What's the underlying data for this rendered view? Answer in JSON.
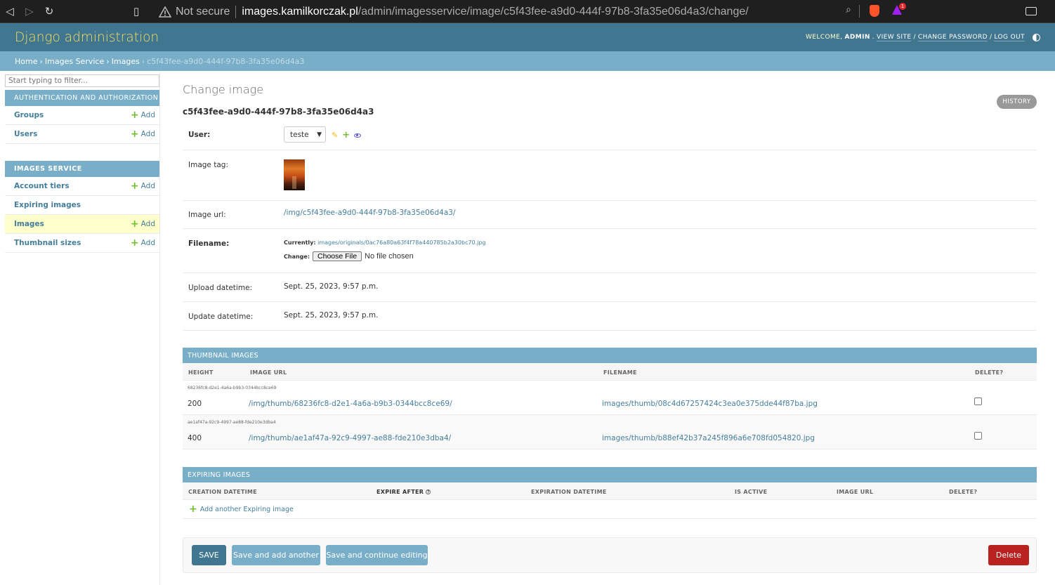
{
  "browser": {
    "security_label": "Not secure",
    "url_host": "images.kamilkorczak.pl",
    "url_path": "/admin/imagesservice/image/c5f43fee-a9d0-444f-97b8-3fa35e06d4a3/change/",
    "notification_count": "1"
  },
  "header": {
    "branding": "Django administration",
    "welcome": "Welcome,",
    "username": "admin",
    "view_site": "View site",
    "change_password": "Change password",
    "log_out": "Log out"
  },
  "breadcrumbs": {
    "home": "Home",
    "app": "Images Service",
    "model": "Images",
    "current": "c5f43fee-a9d0-444f-97b8-3fa35e06d4a3"
  },
  "sidebar": {
    "filter_placeholder": "Start typing to filter...",
    "auth_module": {
      "caption": "Authentication and Authorization",
      "items": [
        {
          "name": "Groups",
          "add": "Add"
        },
        {
          "name": "Users",
          "add": "Add"
        }
      ]
    },
    "images_module": {
      "caption": "Images Service",
      "items": [
        {
          "name": "Account tiers",
          "add": "Add"
        },
        {
          "name": "Expiring images",
          "add": ""
        },
        {
          "name": "Images",
          "add": "Add"
        },
        {
          "name": "Thumbnail sizes",
          "add": "Add"
        }
      ]
    }
  },
  "content": {
    "title": "Change image",
    "object_id": "c5f43fee-a9d0-444f-97b8-3fa35e06d4a3",
    "history": "History",
    "fields": {
      "user_label": "User:",
      "user_value": "teste",
      "image_tag_label": "Image tag:",
      "image_url_label": "Image url:",
      "image_url_value": "/img/c5f43fee-a9d0-444f-97b8-3fa35e06d4a3/",
      "filename_label": "Filename:",
      "currently_label": "Currently:",
      "currently_value": "images/originals/0ac76a80a63f4f78a440785b2a30bc70.jpg",
      "change_label": "Change:",
      "choose_file": "Choose File",
      "no_file": "No file chosen",
      "upload_label": "Upload datetime:",
      "upload_value": "Sept. 25, 2023, 9:57 p.m.",
      "update_label": "Update datetime:",
      "update_value": "Sept. 25, 2023, 9:57 p.m."
    },
    "thumbnails": {
      "caption": "Thumbnail images",
      "headers": [
        "Height",
        "Image url",
        "Filename",
        "Delete?"
      ],
      "rows": [
        {
          "original": "68236fc8-d2e1-4a6a-b9b3-0344bcc8ce69",
          "height": "200",
          "url": "/img/thumb/68236fc8-d2e1-4a6a-b9b3-0344bcc8ce69/",
          "filename": "images/thumb/08c4d67257424c3ea0e375dde44f87ba.jpg"
        },
        {
          "original": "ae1af47a-92c9-4997-ae88-fde210e3dba4",
          "height": "400",
          "url": "/img/thumb/ae1af47a-92c9-4997-ae88-fde210e3dba4/",
          "filename": "images/thumb/b88ef42b37a245f896a6e708fd054820.jpg"
        }
      ]
    },
    "expiring": {
      "caption": "Expiring images",
      "headers": [
        "Creation datetime",
        "Expire after",
        "Expiration datetime",
        "Is active",
        "Image url",
        "Delete?"
      ],
      "add_another": "Add another Expiring image"
    },
    "submit": {
      "save": "Save",
      "save_add": "Save and add another",
      "save_continue": "Save and continue editing",
      "delete": "Delete"
    }
  }
}
